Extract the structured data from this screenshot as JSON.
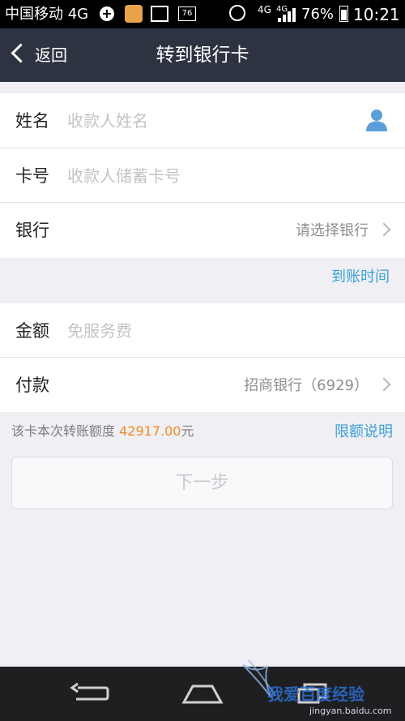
{
  "status_bar": {
    "carrier": "中国移动 4G",
    "badge": "76",
    "net_1": "4G",
    "net_2": "4G",
    "battery": "76%",
    "time": "10:21"
  },
  "header": {
    "back_label": "返回",
    "title": "转到银行卡"
  },
  "form": {
    "name_label": "姓名",
    "name_placeholder": "收款人姓名",
    "card_label": "卡号",
    "card_placeholder": "收款人储蓄卡号",
    "bank_label": "银行",
    "bank_value": "请选择银行"
  },
  "arrival_time_link": "到账时间",
  "payment": {
    "amount_label": "金额",
    "amount_placeholder": "免服务费",
    "pay_label": "付款",
    "pay_value": "招商银行（6929）"
  },
  "quota": {
    "prefix": "该卡本次转账额度",
    "amount": "42917.00",
    "suffix": "元",
    "link": "限额说明"
  },
  "next_button": "下一步",
  "watermark": {
    "text": "我爱百度经验",
    "url": "jingyan.baidu.com"
  },
  "colors": {
    "header_bg": "#2e3341",
    "link": "#3aa1d8",
    "amount": "#f08a24",
    "page_bg": "#efeff4"
  }
}
